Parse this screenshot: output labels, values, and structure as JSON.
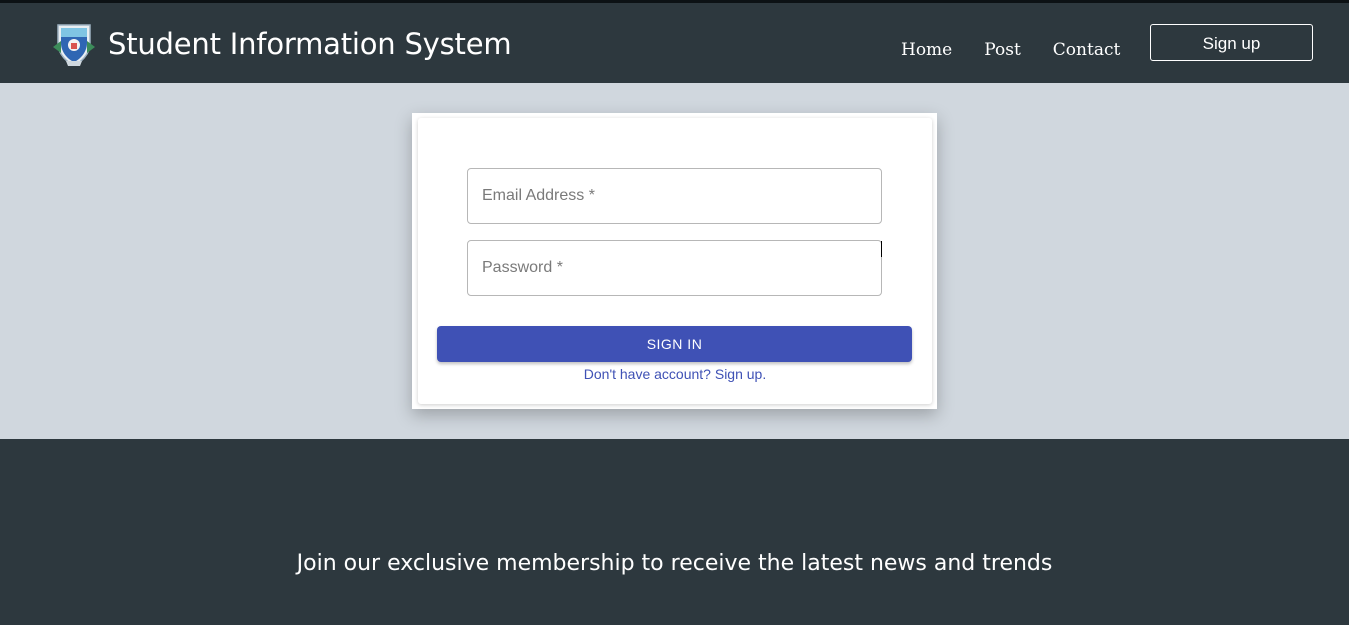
{
  "header": {
    "title": "Student Information System",
    "logo_icon": "university-crest-icon",
    "nav": [
      {
        "label": "Home"
      },
      {
        "label": "Post"
      },
      {
        "label": "Contact"
      }
    ],
    "signup_label": "Sign up"
  },
  "login": {
    "email": {
      "placeholder": "Email Address *",
      "value": ""
    },
    "password": {
      "placeholder": "Password *",
      "value": ""
    },
    "signin_label": "SIGN IN",
    "signup_prompt": "Don't have account? Sign up."
  },
  "footer": {
    "tagline": "Join our exclusive membership to receive the latest news and trends"
  },
  "colors": {
    "header_bg": "#2d383e",
    "page_bg": "#d0d7de",
    "primary": "#3f51b5",
    "text_light": "#ffffff"
  }
}
